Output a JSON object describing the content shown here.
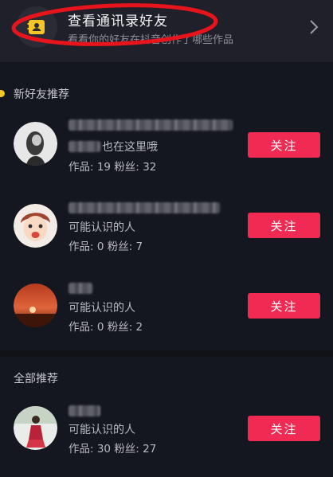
{
  "contacts_card": {
    "title": "查看通讯录好友",
    "subtitle": "看看你的好友在抖音创作了哪些作品",
    "icon": "contacts-book-icon",
    "chevron": "chevron-right-icon"
  },
  "sections": {
    "new_friends": "新好友推荐",
    "all_recommend": "全部推荐"
  },
  "follow_label": "关注",
  "rows": [
    {
      "desc": "也在这里哦",
      "stats": "作品: 19  粉丝: 32"
    },
    {
      "desc": "可能认识的人",
      "stats": "作品: 0  粉丝: 7"
    },
    {
      "desc": "可能认识的人",
      "stats": "作品: 0  粉丝: 2"
    },
    {
      "desc": "可能认识的人",
      "stats": "作品: 30  粉丝: 27"
    }
  ],
  "colors": {
    "accent": "#f12a53",
    "background": "#151720",
    "card": "#1f2029",
    "annotation": "#e8141b",
    "section_dot": "#f7c526"
  }
}
